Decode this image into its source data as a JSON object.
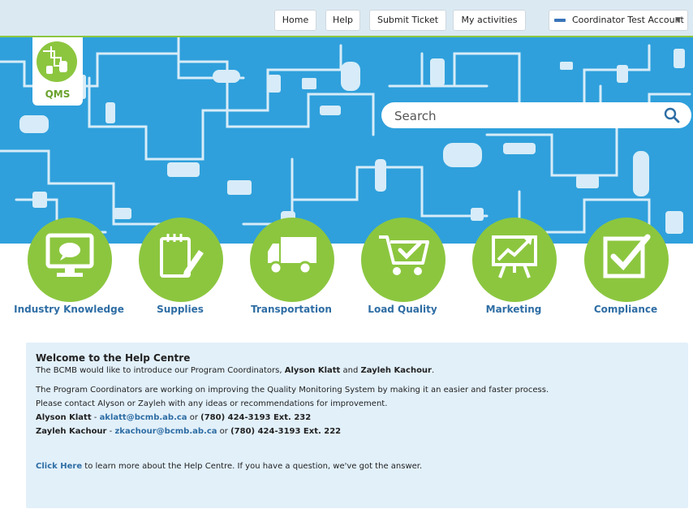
{
  "header": {
    "nav": [
      "Home",
      "Help",
      "Submit Ticket",
      "My activities"
    ],
    "account_label": "Coordinator Test Account",
    "account_caret": "▼"
  },
  "logo": {
    "text": "QMS"
  },
  "search": {
    "placeholder": "Search"
  },
  "categories": [
    {
      "label": "Industry Knowledge",
      "icon": "monitor-chat-icon"
    },
    {
      "label": "Supplies",
      "icon": "notepad-pencil-icon"
    },
    {
      "label": "Transportation",
      "icon": "truck-icon"
    },
    {
      "label": "Load Quality",
      "icon": "cart-check-icon"
    },
    {
      "label": "Marketing",
      "icon": "chart-easel-icon"
    },
    {
      "label": "Compliance",
      "icon": "checkbox-icon"
    }
  ],
  "colors": {
    "accent_green": "#8cc63f",
    "banner_blue": "#2fa0dc",
    "link_blue": "#2e6da4",
    "panel_bg": "#e2f0fa"
  },
  "welcome": {
    "title": "Welcome to the Help Centre",
    "intro_prefix": "The BCMB would like to introduce our Program Coordinators, ",
    "coordinator1": "Alyson Klatt",
    "and": " and ",
    "coordinator2": "Zayleh Kachour",
    "intro_suffix": ".",
    "para2": "The Program Coordinators are working on improving the Quality Monitoring System by making it an easier and faster process.",
    "para3": "Please contact Alyson or Zayleh with any ideas or recommendations for improvement.",
    "contact1": {
      "name": "Alyson Klatt",
      "sep": " - ",
      "email": "aklatt@bcmb.ab.ca",
      "or": " or ",
      "phone": "(780) 424-3193 Ext. 232"
    },
    "contact2": {
      "name": "Zayleh Kachour",
      "sep": " - ",
      "email": "zkachour@bcmb.ab.ca",
      "or": " or ",
      "phone": "(780) 424-3193 Ext. 222"
    },
    "footer_link": "Click Here",
    "footer_text": " to learn more about the Help Centre. If you have a question, we've got the answer."
  }
}
